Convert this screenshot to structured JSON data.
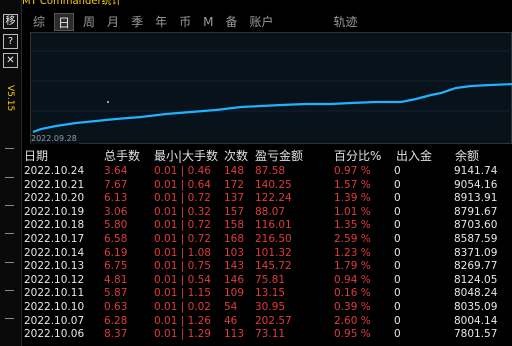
{
  "app": {
    "title": "MT Commander统计"
  },
  "left": {
    "buttons": [
      {
        "label": "移",
        "name": "move-button"
      },
      {
        "label": "?",
        "name": "help-button"
      },
      {
        "label": "✕",
        "name": "close-button"
      }
    ],
    "version_label": "V5.15"
  },
  "tabs": [
    {
      "label": "综",
      "active": false
    },
    {
      "label": "日",
      "active": true
    },
    {
      "label": "周",
      "active": false
    },
    {
      "label": "月",
      "active": false
    },
    {
      "label": "季",
      "active": false
    },
    {
      "label": "年",
      "active": false
    },
    {
      "label": "币",
      "active": false
    },
    {
      "label": "M",
      "active": false
    },
    {
      "label": "备",
      "active": false
    },
    {
      "label": "账户",
      "active": false
    },
    {
      "label": "轨迹",
      "active": false
    }
  ],
  "chart": {
    "start_date": "2022.09.28",
    "line_color": "#1fb2ff"
  },
  "table": {
    "headers": [
      "日期",
      "总手数",
      "最小|大手数",
      "次数",
      "盈亏金额",
      "百分比%",
      "出入金",
      "余额"
    ],
    "rows": [
      [
        "2022.10.24",
        "3.64",
        "0.01 | 0.46",
        "148",
        "87.58",
        "0.97 %",
        "0",
        "9141.74"
      ],
      [
        "2022.10.21",
        "7.67",
        "0.01 | 0.64",
        "172",
        "140.25",
        "1.57 %",
        "0",
        "9054.16"
      ],
      [
        "2022.10.20",
        "6.13",
        "0.01 | 0.72",
        "137",
        "122.24",
        "1.39 %",
        "0",
        "8913.91"
      ],
      [
        "2022.10.19",
        "3.06",
        "0.01 | 0.32",
        "157",
        "88.07",
        "1.01 %",
        "0",
        "8791.67"
      ],
      [
        "2022.10.18",
        "5.80",
        "0.01 | 0.72",
        "158",
        "116.01",
        "1.35 %",
        "0",
        "8703.60"
      ],
      [
        "2022.10.17",
        "6.58",
        "0.01 | 0.72",
        "168",
        "216.50",
        "2.59 %",
        "0",
        "8587.59"
      ],
      [
        "2022.10.14",
        "6.19",
        "0.01 | 1.08",
        "103",
        "101.32",
        "1.23 %",
        "0",
        "8371.09"
      ],
      [
        "2022.10.13",
        "6.75",
        "0.01 | 0.75",
        "143",
        "145.72",
        "1.79 %",
        "0",
        "8269.77"
      ],
      [
        "2022.10.12",
        "4.81",
        "0.01 | 0.54",
        "146",
        "75.81",
        "0.94 %",
        "0",
        "8124.05"
      ],
      [
        "2022.10.11",
        "5.87",
        "0.01 | 1.15",
        "109",
        "13.15",
        "0.16 %",
        "0",
        "8048.24"
      ],
      [
        "2022.10.10",
        "0.63",
        "0.01 | 0.02",
        "54",
        "30.95",
        "0.39 %",
        "0",
        "8035.09"
      ],
      [
        "2022.10.07",
        "6.28",
        "0.01 | 1.26",
        "46",
        "202.57",
        "2.60 %",
        "0",
        "8004.14"
      ],
      [
        "2022.10.06",
        "8.37",
        "0.01 | 1.29",
        "113",
        "73.11",
        "0.95 %",
        "0",
        "7801.57"
      ]
    ]
  }
}
